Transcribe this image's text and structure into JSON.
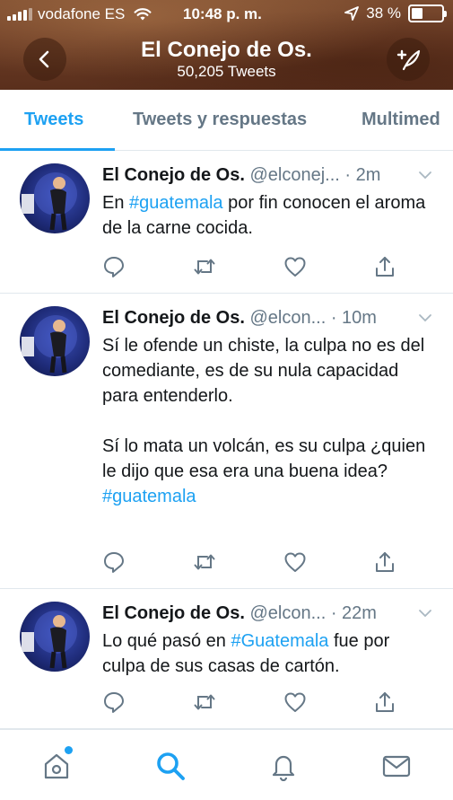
{
  "status_bar": {
    "carrier": "vodafone ES",
    "time": "10:48 p. m.",
    "battery_percent": "38 %",
    "battery_level": 0.38,
    "icons": [
      "signal-icon",
      "wifi-icon",
      "location-icon",
      "battery-icon"
    ]
  },
  "profile": {
    "name": "El Conejo de Os.",
    "tweet_count": "50,205 Tweets",
    "back_icon": "chevron-left-icon",
    "compose_icon": "compose-tweet-icon"
  },
  "tabs": [
    {
      "label": "Tweets",
      "active": true
    },
    {
      "label": "Tweets y respuestas",
      "active": false
    },
    {
      "label": "Multimed",
      "active": false
    }
  ],
  "tweets": [
    {
      "name": "El Conejo de Os.",
      "handle": "@elconej...",
      "time": "· 2m",
      "text_before": "En ",
      "hashtag": "#guatemala",
      "text_after": " por fin conocen el aroma de la carne cocida."
    },
    {
      "name": "El Conejo de Os.",
      "handle": "@elcon...",
      "time": "· 10m",
      "para1": "Sí le ofende un chiste, la culpa no es del comediante, es de su nula capacidad para entenderlo.",
      "para2": "Sí lo mata un volcán, es su culpa ¿quien le dijo que esa era una buena idea?",
      "hashtag": "#guatemala"
    },
    {
      "name": "El Conejo de Os.",
      "handle": "@elcon...",
      "time": "· 22m",
      "text_before": "Lo qué pasó en ",
      "hashtag": "#Guatemala",
      "text_after": " fue por culpa de sus casas de cartón."
    }
  ],
  "tweet_actions": [
    "reply-icon",
    "retweet-icon",
    "like-icon",
    "share-icon"
  ],
  "bottom_nav": [
    {
      "name": "home-icon",
      "active": false,
      "has_dot": true
    },
    {
      "name": "search-icon",
      "active": true
    },
    {
      "name": "notifications-icon",
      "active": false
    },
    {
      "name": "messages-icon",
      "active": false
    }
  ],
  "colors": {
    "accent": "#1da1f2",
    "secondary_text": "#657786",
    "primary_text": "#14171a"
  }
}
